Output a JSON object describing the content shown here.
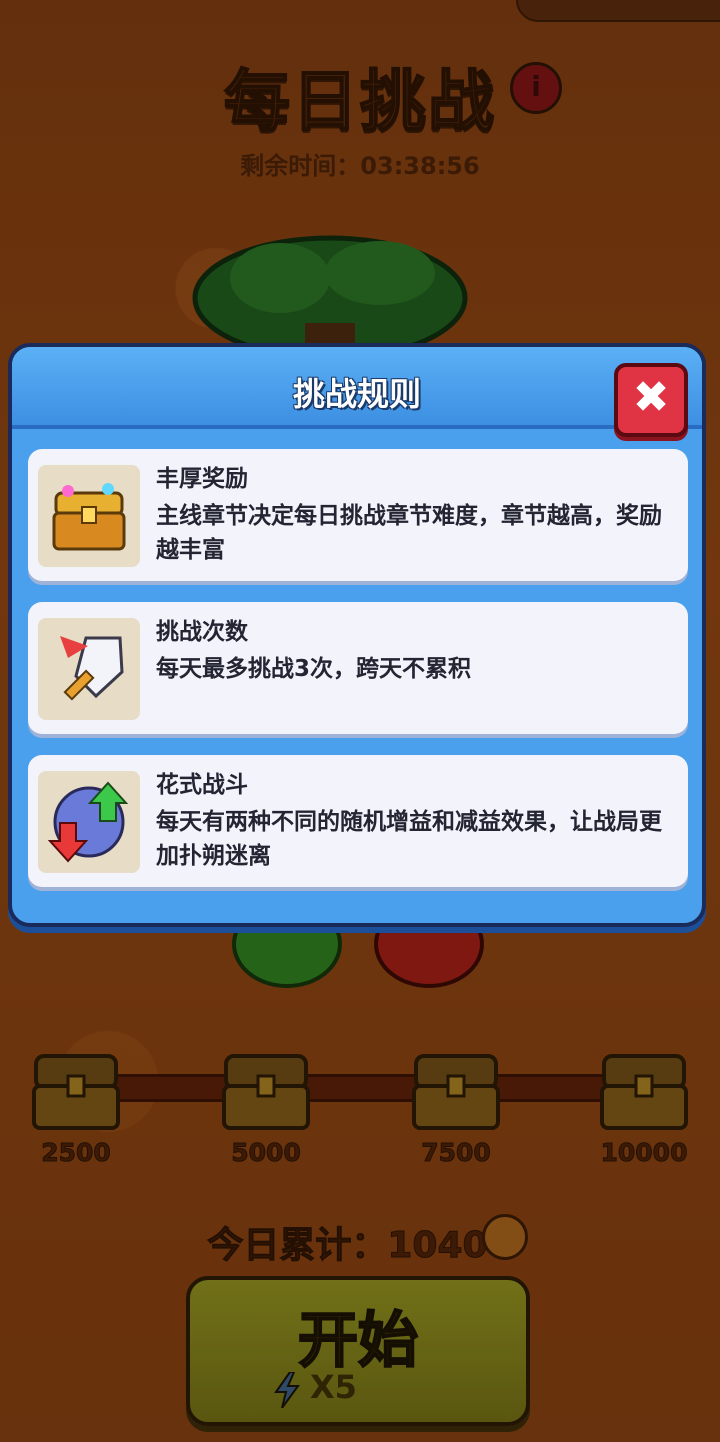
{
  "header": {
    "title": "每日挑战",
    "info_label": "i",
    "timer_label": "剩余时间：",
    "timer_value": "03:38:56"
  },
  "modal": {
    "title": "挑战规则",
    "close_label": "✖",
    "rules": [
      {
        "icon": "treasure-chest-icon",
        "title": "丰厚奖励",
        "desc": "主线章节决定每日挑战章节难度，章节越高，奖励越丰富"
      },
      {
        "icon": "sword-icon",
        "title": "挑战次数",
        "desc": "每天最多挑战3次，跨天不累积"
      },
      {
        "icon": "buff-debuff-icon",
        "title": "花式战斗",
        "desc": "每天有两种不同的随机增益和减益效果，让战局更加扑朔迷离"
      }
    ]
  },
  "progress": {
    "milestones": [
      "2500",
      "5000",
      "7500",
      "10000"
    ]
  },
  "total": {
    "label": "今日累计：",
    "value": "10400"
  },
  "start": {
    "label": "开始",
    "cost": "X5"
  },
  "colors": {
    "modal_blue": "#4aa0ec",
    "close_red": "#e03444",
    "background": "#8b4412"
  }
}
